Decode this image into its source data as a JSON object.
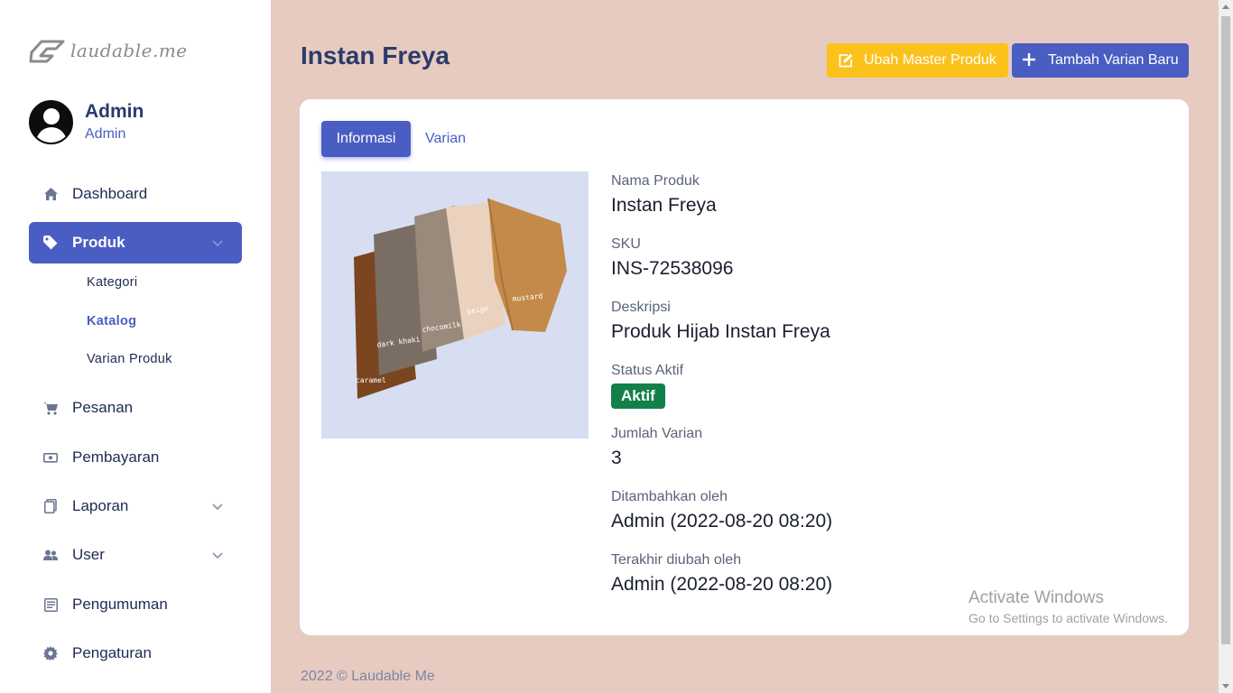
{
  "brand": {
    "logo_text": "laudable.me"
  },
  "profile": {
    "name": "Admin",
    "role": "Admin"
  },
  "sidebar": {
    "items": [
      {
        "label": "Dashboard",
        "icon": "home-icon"
      },
      {
        "label": "Produk",
        "icon": "tag-icon",
        "active": true,
        "expanded": true
      },
      {
        "label": "Pesanan",
        "icon": "cart-icon"
      },
      {
        "label": "Pembayaran",
        "icon": "cash-icon"
      },
      {
        "label": "Laporan",
        "icon": "report-icon",
        "has_children": true
      },
      {
        "label": "User",
        "icon": "users-icon",
        "has_children": true
      },
      {
        "label": "Pengumuman",
        "icon": "announcement-icon"
      },
      {
        "label": "Pengaturan",
        "icon": "gear-icon"
      }
    ],
    "produk_sub": [
      {
        "label": "Kategori"
      },
      {
        "label": "Katalog",
        "active": true
      },
      {
        "label": "Varian Produk"
      }
    ]
  },
  "header": {
    "title": "Instan Freya",
    "edit_button": "Ubah Master Produk",
    "add_button": "Tambah Varian Baru"
  },
  "tabs": [
    {
      "label": "Informasi",
      "active": true
    },
    {
      "label": "Varian",
      "active": false
    }
  ],
  "product": {
    "image_labels": [
      "caramel",
      "dark khaki",
      "chocomilk",
      "beige",
      "mustard"
    ],
    "fields": [
      {
        "label": "Nama Produk",
        "value": "Instan Freya"
      },
      {
        "label": "SKU",
        "value": "INS-72538096"
      },
      {
        "label": "Deskripsi",
        "value": "Produk Hijab Instan Freya"
      },
      {
        "label": "Status Aktif",
        "value": "Aktif"
      },
      {
        "label": "Jumlah Varian",
        "value": "3"
      },
      {
        "label": "Ditambahkan oleh",
        "value": "Admin (2022-08-20 08:20)"
      },
      {
        "label": "Terakhir diubah oleh",
        "value": "Admin (2022-08-20 08:20)"
      }
    ]
  },
  "watermark": {
    "line1": "Activate Windows",
    "line2": "Go to Settings to activate Windows."
  },
  "footer": {
    "text": "2022 © Laudable Me"
  },
  "colors": {
    "primary": "#4a5dc3",
    "warning": "#fbc21b",
    "success": "#13804a",
    "page_bg": "#e7cbc0"
  }
}
